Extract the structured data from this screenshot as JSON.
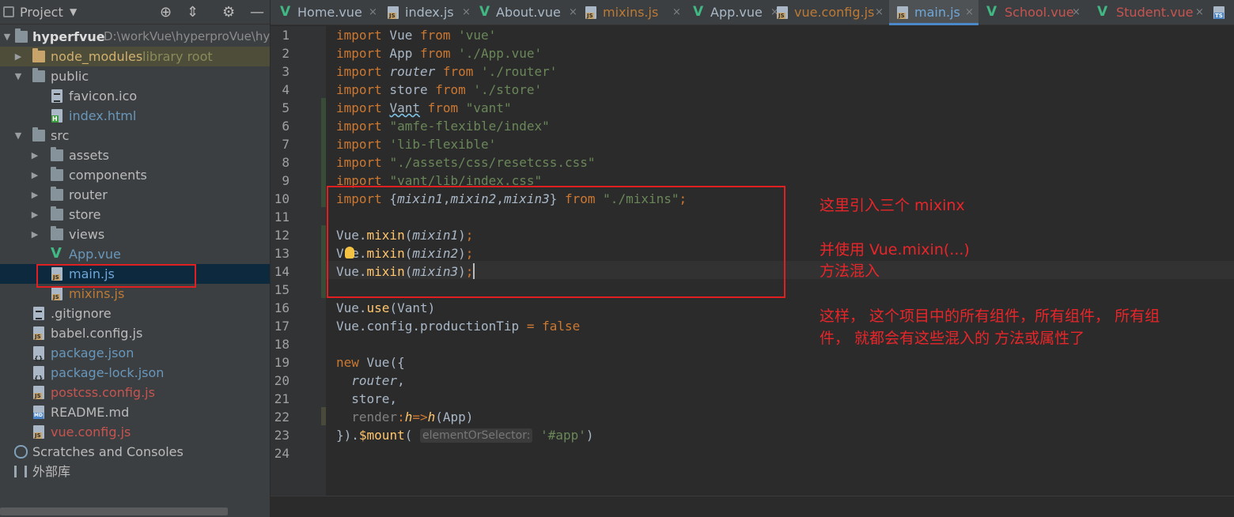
{
  "project_panel": {
    "title": "Project",
    "tree": [
      {
        "label": "hyperfvue",
        "suffix": "D:\\workVue\\hyperproVue\\hy"
      },
      {
        "label": "node_modules",
        "suffix": "library root"
      },
      {
        "label": "public"
      },
      {
        "label": "favicon.ico"
      },
      {
        "label": "index.html"
      },
      {
        "label": "src"
      },
      {
        "label": "assets"
      },
      {
        "label": "components"
      },
      {
        "label": "router"
      },
      {
        "label": "store"
      },
      {
        "label": "views"
      },
      {
        "label": "App.vue"
      },
      {
        "label": "main.js"
      },
      {
        "label": "mixins.js"
      },
      {
        "label": ".gitignore"
      },
      {
        "label": "babel.config.js"
      },
      {
        "label": "package.json"
      },
      {
        "label": "package-lock.json"
      },
      {
        "label": "postcss.config.js"
      },
      {
        "label": "README.md"
      },
      {
        "label": "vue.config.js"
      },
      {
        "label": "Scratches and Consoles"
      },
      {
        "label": "外部库"
      }
    ]
  },
  "tabs": [
    {
      "label": "Home.vue"
    },
    {
      "label": "index.js"
    },
    {
      "label": "About.vue"
    },
    {
      "label": "mixins.js"
    },
    {
      "label": "App.vue"
    },
    {
      "label": "vue.config.js"
    },
    {
      "label": "main.js"
    },
    {
      "label": "School.vue"
    },
    {
      "label": "Student.vue"
    }
  ],
  "tab_close_glyph": "×",
  "editor": {
    "line_numbers": [
      "1",
      "2",
      "3",
      "4",
      "5",
      "6",
      "7",
      "8",
      "9",
      "10",
      "11",
      "12",
      "13",
      "14",
      "15",
      "16",
      "17",
      "18",
      "19",
      "20",
      "21",
      "22",
      "23",
      "24"
    ],
    "current_line": 14,
    "inlay_hint": "elementOrSelector:"
  },
  "annotations": {
    "note1": "这里引入三个 mixinx",
    "note2_line1": "并使用 Vue.mixin(...)",
    "note2_line2": "方法混入",
    "note3_line1": "这样， 这个项目中的所有组件，所有组件， 所有组",
    "note3_line2": "件， 就都会有这些混入的 方法或属性了"
  },
  "colors": {
    "keyword": "#cc7832",
    "string": "#6a8759",
    "function": "#ffc66d",
    "annotation": "#e8262a",
    "selection_box": "#e02020",
    "vue_green": "#41b883"
  }
}
